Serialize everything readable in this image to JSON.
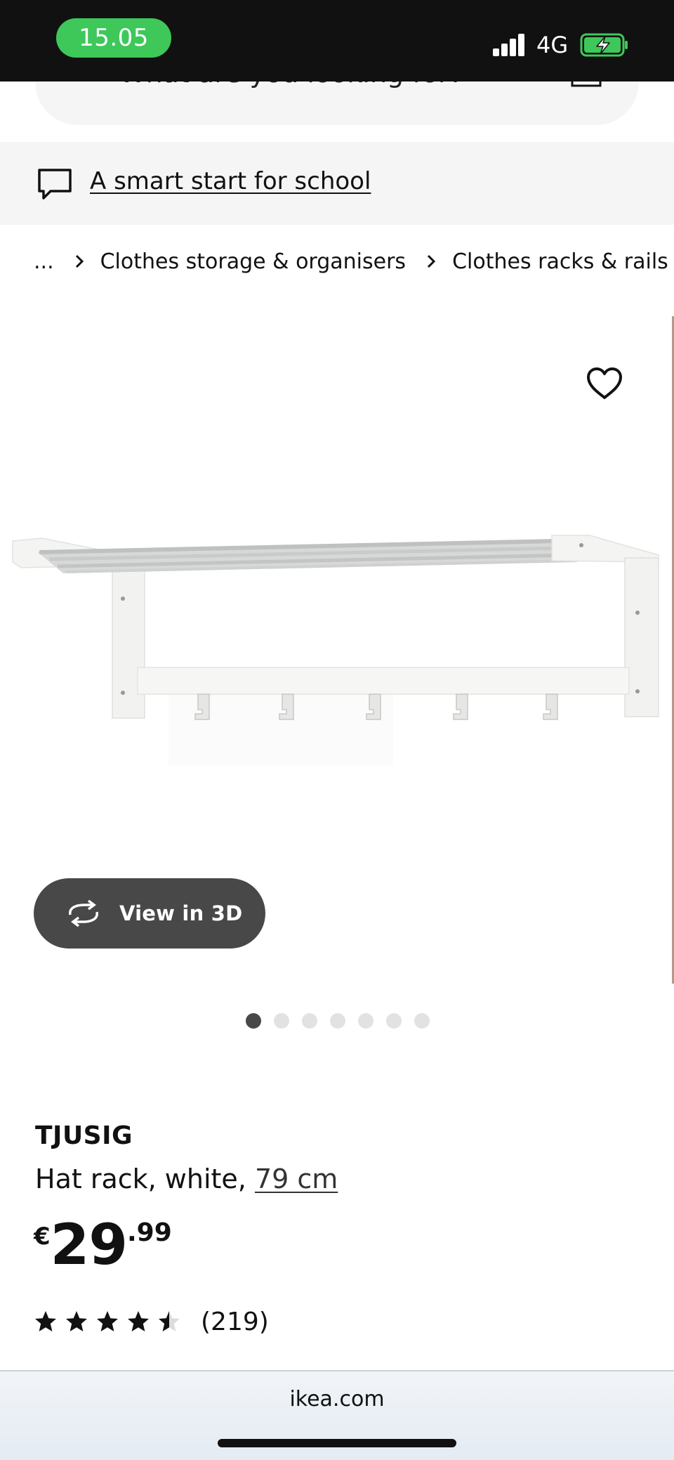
{
  "status_bar": {
    "time": "15.05",
    "network": "4G",
    "colors": {
      "time_pill": "#3ec85a",
      "battery": "#3ec85a"
    }
  },
  "search": {
    "placeholder": "What are you looking for?"
  },
  "promo": {
    "link_text": "A smart start for school"
  },
  "breadcrumb": {
    "items": [
      "...",
      "Clothes storage & organisers",
      "Clothes racks & rails"
    ]
  },
  "gallery": {
    "view_3d_label": "View in 3D",
    "slide_count": 7,
    "active_slide": 1
  },
  "product": {
    "brand": "TJUSIG",
    "description": "Hat rack, white,",
    "size_link": "79 cm",
    "price": {
      "currency": "€",
      "integer": "29",
      "decimal": ".99"
    },
    "rating": {
      "value": 4.5,
      "max": 5,
      "count_label": "(219)"
    }
  },
  "browser": {
    "url": "ikea.com"
  }
}
